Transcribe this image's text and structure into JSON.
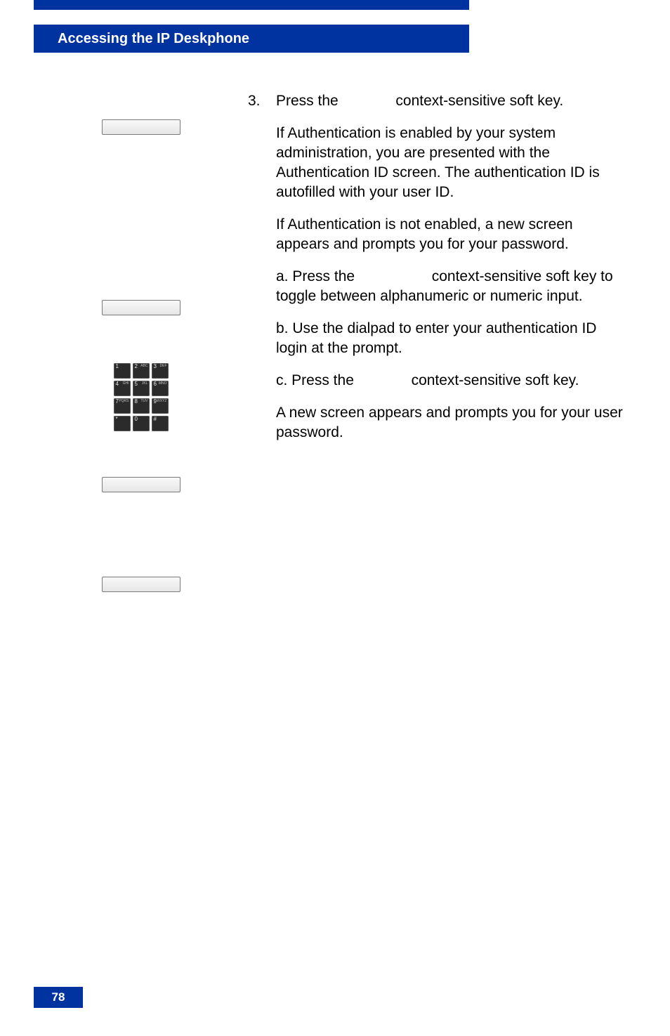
{
  "header": {
    "title": "Accessing the IP Deskphone"
  },
  "step": {
    "number": "3.",
    "line1_a": "Press the ",
    "line1_b": " context-sensitive soft key.",
    "para1": "If Authentication is enabled by your system administration, you are presented with the Authentication ID screen. The authentication ID is autofilled with your user ID.",
    "para2": "If Authentication is not enabled, a new screen appears and prompts you for your password.",
    "a_1": "a. Press the ",
    "a_2": " context-sensitive soft key to toggle between alphanumeric or numeric input.",
    "b": "b. Use the dialpad to enter your authentication ID login at the prompt.",
    "c_1": "c. Press the ",
    "c_2": " context-sensitive soft key.",
    "para3": "A new screen appears and prompts you for your user password."
  },
  "dialpad": {
    "keys": [
      {
        "g": "1",
        "s": ""
      },
      {
        "g": "2",
        "s": "ABC"
      },
      {
        "g": "3",
        "s": "DEF"
      },
      {
        "g": "4",
        "s": "GHI"
      },
      {
        "g": "5",
        "s": "JKL"
      },
      {
        "g": "6",
        "s": "MNO"
      },
      {
        "g": "7",
        "s": "PQRS"
      },
      {
        "g": "8",
        "s": "TUV"
      },
      {
        "g": "9",
        "s": "WXYZ"
      },
      {
        "g": "*",
        "s": ""
      },
      {
        "g": "0",
        "s": ""
      },
      {
        "g": "#",
        "s": ""
      }
    ]
  },
  "page": {
    "number": "78"
  }
}
